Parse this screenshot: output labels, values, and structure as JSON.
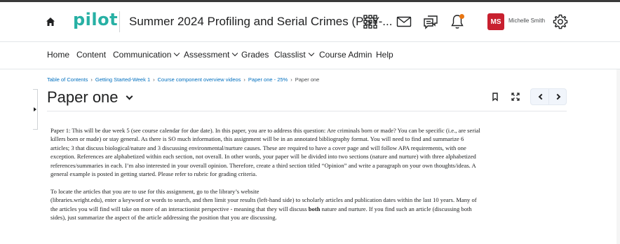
{
  "header": {
    "logo": "pilot",
    "course_title": "Summer 2024 Profiling and Serial Crimes (PSY-...",
    "avatar_initials": "MS",
    "user_name": "Michelle Smith",
    "notification_color": "#e87511",
    "brand_color": "#27b0a4",
    "avatar_color": "#c8202f",
    "icons": [
      "home-icon",
      "grid-icon",
      "mail-icon",
      "chat-icon",
      "bell-icon",
      "gear-icon"
    ]
  },
  "nav": {
    "items": [
      {
        "label": "Home",
        "dropdown": false
      },
      {
        "label": "Content",
        "dropdown": false
      },
      {
        "label": "Communication",
        "dropdown": true
      },
      {
        "label": "Assessment",
        "dropdown": true
      },
      {
        "label": "Grades",
        "dropdown": false
      },
      {
        "label": "Classlist",
        "dropdown": true
      },
      {
        "label": "Course Admin",
        "dropdown": false
      },
      {
        "label": "Help",
        "dropdown": false
      }
    ]
  },
  "breadcrumbs": {
    "items": [
      "Table of Contents",
      "Getting Started-Week 1",
      "Course component overview videos",
      "Paper one - 25%"
    ],
    "current": "Paper one",
    "separator": "›"
  },
  "page": {
    "title": "Paper one",
    "icons": [
      "bookmark-icon",
      "fullscreen-icon",
      "previous-icon",
      "next-icon"
    ]
  },
  "document": {
    "p1_lines": [
      "Paper 1: This will be due week 5 (see course calendar for due date). In this paper, you are to address this question: Are criminals born or made? You can be specific (i.e., are serial",
      "killers born or made) or stay general.  As there is SO much information, this assignment will be in an annotated bibliography format. You will need to find and summarize 6",
      "articles; 3 that discuss biological/nature and 3 discussing environmental/nurture causes. These are required to have a cover page and will follow APA requirements, with one",
      "exception. References are alphabetized within each section, not overall. In other words, your paper will be divided into two sections (nature and nurture) with three alphabetized",
      "references/summaries in each. I’m also interested in your overall opinion. Therefore, create a third section titled “Opinion” and write a paragraph on your own thoughts/ideas. A",
      "general example is posted in getting started. Please refer to rubric for grading criteria."
    ],
    "p2_line1": "To locate the articles that you are to use for this assignment, go to the library’s website",
    "p2_line2": " (libraries.wright.edu), enter a keyword or words to search, and then limit your results (left-hand side) to scholarly articles and publication dates within the last 10 years. Many of",
    "p2_line3_before": "the articles you will find will take on more of an interactionist perspective - meaning that they will discuss ",
    "p2_line3_bold": "both",
    "p2_line3_after": " nature and nurture. If you find such an article (discussing both",
    "p2_line4": "sides), just summarize the aspect of the article addressing the position that you are discussing."
  }
}
